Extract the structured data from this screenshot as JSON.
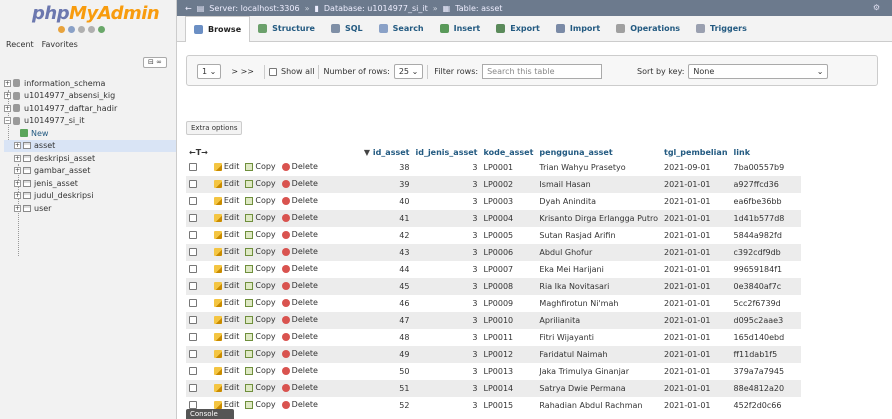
{
  "sidebar": {
    "logo_a": "php",
    "logo_b": "MyAdmin",
    "recent": "Recent",
    "favorites": "Favorites",
    "collapse": "⊟ ∞",
    "items": [
      {
        "label": "information_schema"
      },
      {
        "label": "u1014977_absensi_kig"
      },
      {
        "label": "u1014977_daftar_hadir"
      },
      {
        "label": "u1014977_si_it"
      },
      {
        "label": "New"
      },
      {
        "label": "asset"
      },
      {
        "label": "deskripsi_asset"
      },
      {
        "label": "gambar_asset"
      },
      {
        "label": "jenis_asset"
      },
      {
        "label": "judul_deskripsi"
      },
      {
        "label": "user"
      }
    ]
  },
  "breadcrumb": {
    "server": "Server: localhost:3306",
    "database": "Database: u1014977_si_it",
    "table": "Table: asset",
    "sep": "»"
  },
  "tabs": [
    {
      "label": "Browse",
      "color": "#6b8fc4"
    },
    {
      "label": "Structure",
      "color": "#6ba06b"
    },
    {
      "label": "SQL",
      "color": "#7f8fa6"
    },
    {
      "label": "Search",
      "color": "#8aa1c7"
    },
    {
      "label": "Insert",
      "color": "#5a9a5a"
    },
    {
      "label": "Export",
      "color": "#5a8a5a"
    },
    {
      "label": "Import",
      "color": "#7a8aa6"
    },
    {
      "label": "Operations",
      "color": "#a0a0a0"
    },
    {
      "label": "Triggers",
      "color": "#9aa0b0"
    }
  ],
  "navigation": {
    "page": "1",
    "next": "> >>",
    "show_all": "Show all",
    "rows_label": "Number of rows:",
    "rows_value": "25",
    "filter_label": "Filter rows:",
    "filter_placeholder": "Search this table",
    "sort_label": "Sort by key:",
    "sort_value": "None"
  },
  "extra_options": "Extra options",
  "table": {
    "arrows": "←T→",
    "headers": [
      "id_asset",
      "id_jenis_asset",
      "kode_asset",
      "pengguna_asset",
      "tgl_pembelian",
      "link"
    ],
    "sort_marker": "▼",
    "actions": {
      "edit": "Edit",
      "copy": "Copy",
      "delete": "Delete"
    },
    "rows": [
      [
        "38",
        "3",
        "LP0001",
        "Trian Wahyu Prasetyo",
        "2021-09-01",
        "7ba00557b9"
      ],
      [
        "39",
        "3",
        "LP0002",
        "Ismail Hasan",
        "2021-01-01",
        "a927ffcd36"
      ],
      [
        "40",
        "3",
        "LP0003",
        "Dyah Anindita",
        "2021-01-01",
        "ea6fbe36bb"
      ],
      [
        "41",
        "3",
        "LP0004",
        "Krisanto Dirga Erlangga Putro",
        "2021-01-01",
        "1d41b577d8"
      ],
      [
        "42",
        "3",
        "LP0005",
        "Sutan Rasjad Arifin",
        "2021-01-01",
        "5844a982fd"
      ],
      [
        "43",
        "3",
        "LP0006",
        "Abdul Ghofur",
        "2021-01-01",
        "c392cdf9db"
      ],
      [
        "44",
        "3",
        "LP0007",
        "Eka Mei Harijani",
        "2021-01-01",
        "99659184f1"
      ],
      [
        "45",
        "3",
        "LP0008",
        "Ria Ika Novitasari",
        "2021-01-01",
        "0e3840af7c"
      ],
      [
        "46",
        "3",
        "LP0009",
        "Maghfirotun Ni'mah",
        "2021-01-01",
        "5cc2f6739d"
      ],
      [
        "47",
        "3",
        "LP0010",
        "Aprilianita",
        "2021-01-01",
        "d095c2aae3"
      ],
      [
        "48",
        "3",
        "LP0011",
        "Fitri Wijayanti",
        "2021-01-01",
        "165d140ebd"
      ],
      [
        "49",
        "3",
        "LP0012",
        "Faridatul Naimah",
        "2021-01-01",
        "ff11dab1f5"
      ],
      [
        "50",
        "3",
        "LP0013",
        "Jaka Trimulya Ginanjar",
        "2021-01-01",
        "379a7a7945"
      ],
      [
        "51",
        "3",
        "LP0014",
        "Satrya Dwie Permana",
        "2021-01-01",
        "88e4812a20"
      ],
      [
        "52",
        "3",
        "LP0015",
        "Rahadian Abdul Rachman",
        "2021-01-01",
        "452f2d0c66"
      ]
    ]
  },
  "console": "Console"
}
